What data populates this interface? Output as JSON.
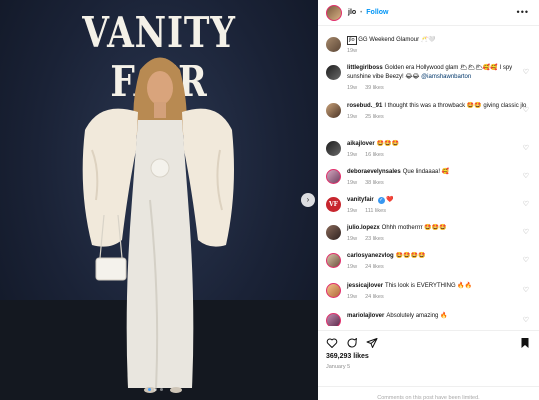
{
  "post": {
    "brand": "VANITY FAIR",
    "author": "jlo",
    "follow_label": "Follow",
    "separator": "•",
    "more": "•••",
    "caption_tag": "jlo",
    "caption_text": "GG Weekend Glamour 🥂🤍",
    "caption_time": "19w",
    "likes": "369,293 likes",
    "date": "January 5",
    "comments_limited": "Comments on this post have been limited.",
    "next_arrow": "›"
  },
  "comments": [
    {
      "user": "littlegirlboss",
      "text": "Golden era Hollywood glam 🌥🌥🌥🥰🥰 I spy sunshine vibe Beezy! 😂😂",
      "mention": "@iamshawnbarton",
      "time": "19w",
      "likes": "39 likes"
    },
    {
      "user": "rosebud._91",
      "text": "I thought this was a throwback 🤩🤩 giving classic",
      "mention": "jlo",
      "time": "19w",
      "likes": "25 likes"
    },
    {
      "user": "aikajlover",
      "text": "🤩🤩🤩",
      "time": "19w",
      "likes": "16 likes"
    },
    {
      "user": "deboraevelynsales",
      "text": "Que lindaaaa! 🥰",
      "time": "19w",
      "likes": "38 likes"
    },
    {
      "user": "vanityfair",
      "text": "❤️",
      "time": "19w",
      "likes": "111 likes",
      "avatar_text": "VF"
    },
    {
      "user": "julio.lopezx",
      "text": "Ohhh motherrrr 🤩🤩🤩",
      "time": "19w",
      "likes": "23 likes"
    },
    {
      "user": "carlosyanezvlog",
      "text": "🤩🤩🤩🤩",
      "time": "19w",
      "likes": "24 likes"
    },
    {
      "user": "jessicajlover",
      "text": "This look is EVERYTHING 🔥🔥",
      "time": "19w",
      "likes": "24 likes"
    },
    {
      "user": "mariolajlover",
      "text": "Absolutely amazing 🔥",
      "time": "19w",
      "likes": ""
    }
  ],
  "colors": {
    "accent": "#0095f6",
    "story_ring": "#e1306c"
  },
  "icons": [
    "heart-icon",
    "comment-icon",
    "share-icon",
    "bookmark-icon",
    "more-icon",
    "verified-icon"
  ]
}
